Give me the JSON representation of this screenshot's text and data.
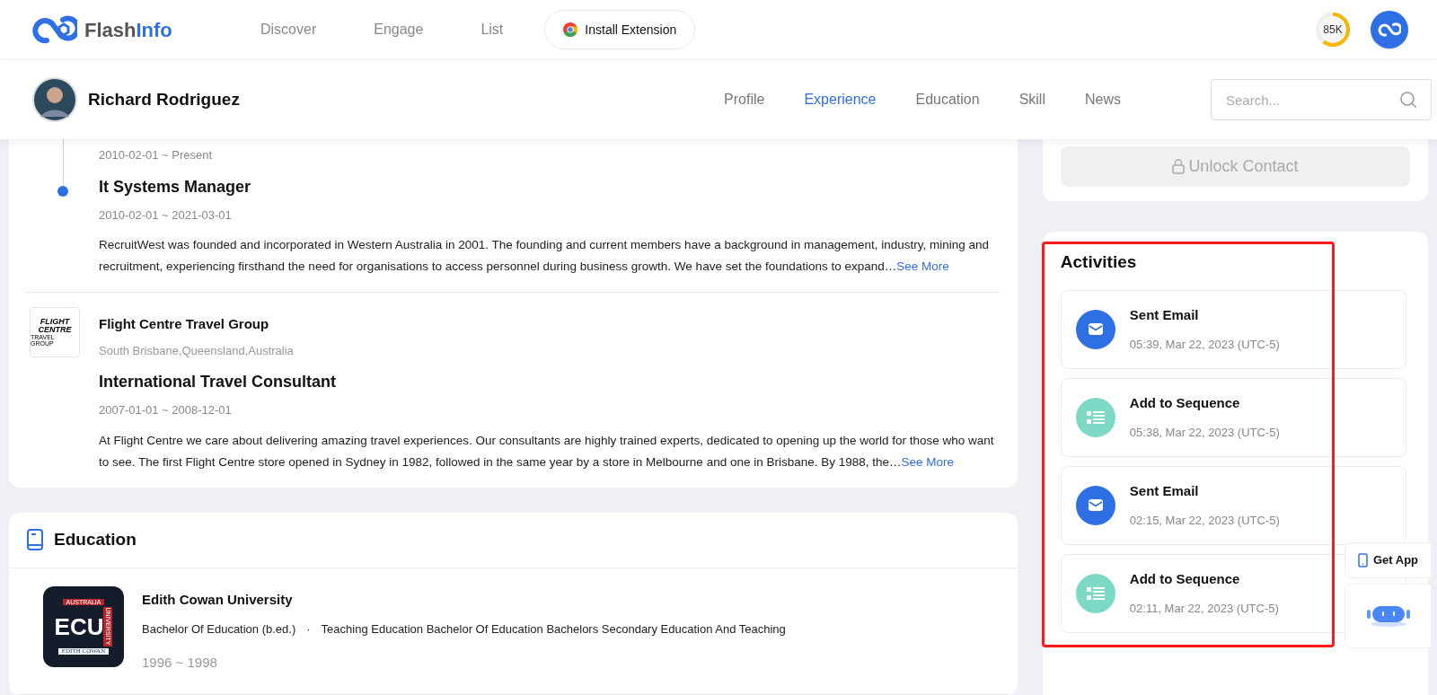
{
  "brand": {
    "part_1": "Flash",
    "part_2": "Info"
  },
  "nav": [
    {
      "label": "Discover"
    },
    {
      "label": "Engage"
    },
    {
      "label": "List"
    }
  ],
  "install_button": "Install Extension",
  "credits": {
    "label": "85K",
    "level": 0.6
  },
  "profile": {
    "name": "Richard Rodriguez"
  },
  "tabs": [
    {
      "label": "Profile",
      "selected": false
    },
    {
      "label": "Experience",
      "selected": true
    },
    {
      "label": "Education",
      "selected": false
    },
    {
      "label": "Skill",
      "selected": false
    },
    {
      "label": "News",
      "selected": false
    }
  ],
  "search": {
    "placeholder": "Search..."
  },
  "experience": [
    {
      "positions": [
        {
          "dates": "2010-02-01 ~ Present"
        },
        {
          "title": "It Systems Manager",
          "dates": "2010-02-01 ~ 2021-03-01",
          "description": "RecruitWest was founded and incorporated in Western Australia in 2001. The founding and current members have a background in management, industry, mining and recruitment, experiencing firsthand the need for organisations to access personnel during business growth. We have set the foundations to expand…",
          "more": "See More"
        }
      ]
    },
    {
      "name": "Flight Centre Travel Group",
      "location": "South Brisbane,Queensland,Australia",
      "logo": {
        "line_1": "FLIGHT",
        "line_2": "CENTRE",
        "line_3": "TRAVEL GROUP"
      },
      "positions": [
        {
          "title": "International Travel Consultant",
          "dates": "2007-01-01 ~ 2008-12-01",
          "description": "At Flight Centre we care about delivering amazing travel experiences. Our consultants are highly trained experts, dedicated to opening up the world for those who want to see. The first Flight Centre store opened in Sydney in 1982, followed in the same year by a store in Melbourne and one in Brisbane. By 1988, the…",
          "more": "See More"
        }
      ]
    }
  ],
  "education": {
    "title": "Education",
    "items": [
      {
        "school": "Edith Cowan University",
        "degree": "Bachelor Of Education (b.ed.)",
        "separator": "·",
        "field": "Teaching Education Bachelor Of Education Bachelors Secondary Education And Teaching",
        "years": "1996 ~ 1998",
        "logo": {
          "top": "AUSTRALIA",
          "main": "ECU",
          "side": "UNIVERSITY",
          "bottom": "EDITH COWAN"
        }
      }
    ]
  },
  "unlock_button": "Unlock Contact",
  "activities": {
    "title": "Activities",
    "items": [
      {
        "kind": "email",
        "title": "Sent Email",
        "time": "05:39, Mar 22, 2023 (UTC-5)"
      },
      {
        "kind": "sequence",
        "title": "Add to Sequence",
        "time": "05:38, Mar 22, 2023 (UTC-5)"
      },
      {
        "kind": "email",
        "title": "Sent Email",
        "time": "02:15, Mar 22, 2023 (UTC-5)"
      },
      {
        "kind": "sequence",
        "title": "Add to Sequence",
        "time": "02:11, Mar 22, 2023 (UTC-5)"
      }
    ]
  },
  "get_app": "Get App"
}
